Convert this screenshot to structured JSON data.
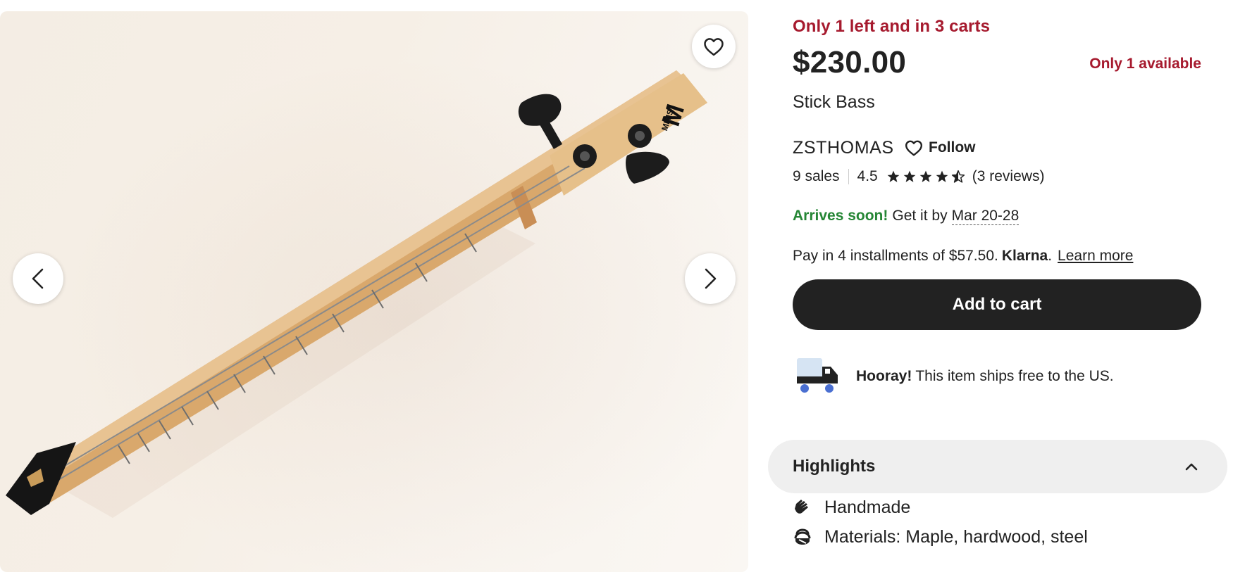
{
  "listing": {
    "stock_alert": "Only 1 left and in 3 carts",
    "price": "$230.00",
    "availability": "Only 1 available",
    "title": "Stick Bass"
  },
  "photo": {
    "brand_mark": "M",
    "brand_small": "MIMS"
  },
  "shop": {
    "name": "ZSTHOMAS",
    "follow_label": "Follow",
    "sales": "9 sales",
    "rating": "4.5",
    "rating_value": 4.5,
    "reviews": "(3 reviews)"
  },
  "delivery": {
    "arrives_label": "Arrives soon!",
    "get_it_by": "Get it by",
    "date": "Mar 20-28"
  },
  "payment": {
    "installments_text": "Pay in 4 installments of $57.50.",
    "provider": "Klarna",
    "provider_suffix": ".",
    "learn_more": "Learn more"
  },
  "cart": {
    "add_label": "Add to cart"
  },
  "shipping": {
    "hooray": "Hooray!",
    "message": "This item ships free to the US."
  },
  "highlights": {
    "title": "Highlights",
    "expanded": true,
    "items": [
      {
        "icon": "hand-icon",
        "text": "Handmade"
      },
      {
        "icon": "materials-icon",
        "text": "Materials: Maple, hardwood, steel"
      }
    ]
  },
  "colors": {
    "alert_red": "#a61a2e",
    "success_green": "#258635",
    "cta_black": "#222222",
    "highlights_bg": "#efefef",
    "truck_blue": "#4a6fd1"
  }
}
